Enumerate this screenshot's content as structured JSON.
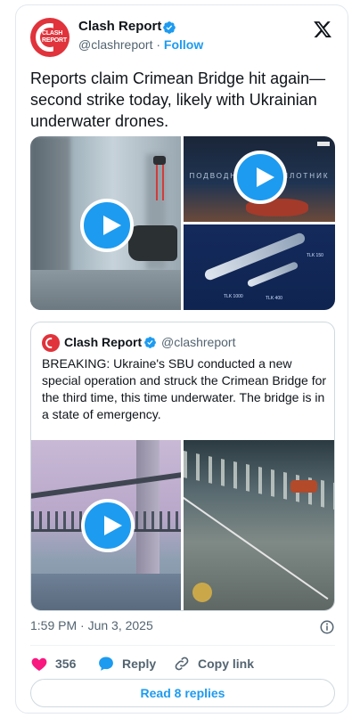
{
  "author": {
    "name": "Clash Report",
    "handle": "@clashreport",
    "follow_label": "Follow",
    "avatar_text_top": "CLASH",
    "avatar_text_bottom": "REPORT"
  },
  "tweet": {
    "text": "Reports claim Crimean Bridge hit again—second strike today, likely with Ukrainian underwater drones.",
    "timestamp": "1:59 PM · Jun 3, 2025"
  },
  "quoted": {
    "name": "Clash Report",
    "handle": "@clashreport",
    "text": "BREAKING: Ukraine's SBU conducted a new special operation and struck the Crimean Bridge for the third time, this time underwater. The bridge is in a state of emergency."
  },
  "media_captions": {
    "video_overlay_text": "ПОДВОДНЫЙ БЕСПИЛОТНИК",
    "drone_label_1": "TLK 1000",
    "drone_label_2": "TLK 400",
    "drone_label_3": "TLK 150"
  },
  "actions": {
    "likes": "356",
    "reply_label": "Reply",
    "copy_label": "Copy link",
    "read_replies": "Read 8 replies"
  },
  "colors": {
    "accent": "#1d9bf0",
    "like": "#f91880",
    "brand_red": "#e0333b"
  }
}
